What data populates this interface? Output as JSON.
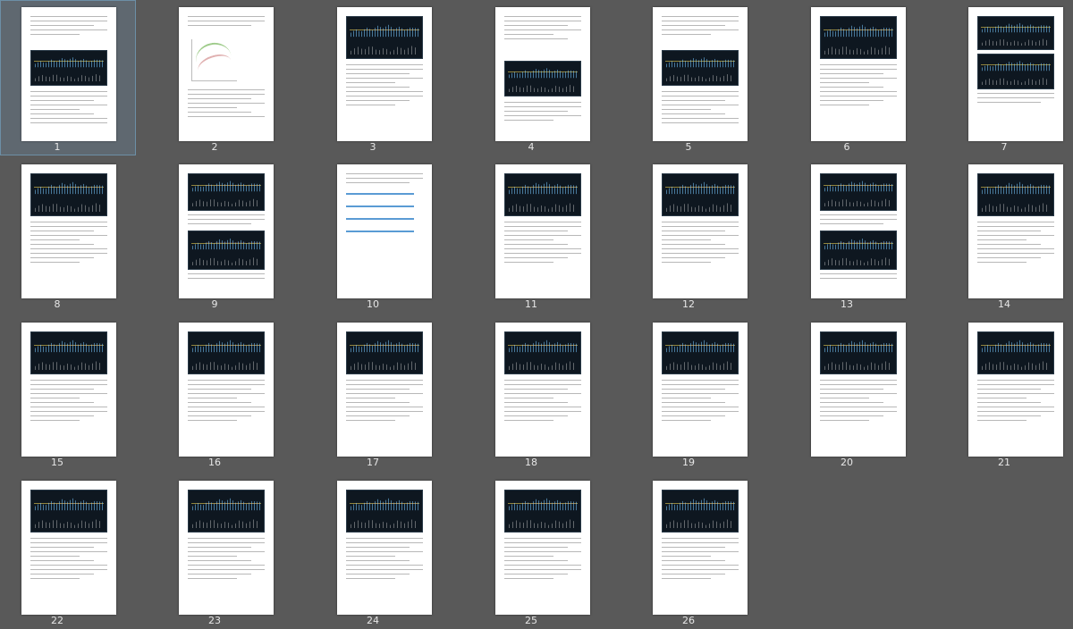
{
  "pages": [
    {
      "label": "1",
      "selected": true,
      "kind": "text-chart"
    },
    {
      "label": "2",
      "selected": false,
      "kind": "sketch"
    },
    {
      "label": "3",
      "selected": false,
      "kind": "chart-text"
    },
    {
      "label": "4",
      "selected": false,
      "kind": "text-chart-text"
    },
    {
      "label": "5",
      "selected": false,
      "kind": "text-chart"
    },
    {
      "label": "6",
      "selected": false,
      "kind": "chart-text"
    },
    {
      "label": "7",
      "selected": false,
      "kind": "two-charts"
    },
    {
      "label": "8",
      "selected": false,
      "kind": "chart-text"
    },
    {
      "label": "9",
      "selected": false,
      "kind": "chart-text-chart"
    },
    {
      "label": "10",
      "selected": false,
      "kind": "links"
    },
    {
      "label": "11",
      "selected": false,
      "kind": "chart-text"
    },
    {
      "label": "12",
      "selected": false,
      "kind": "chart-text"
    },
    {
      "label": "13",
      "selected": false,
      "kind": "chart-text-chart"
    },
    {
      "label": "14",
      "selected": false,
      "kind": "chart-text"
    },
    {
      "label": "15",
      "selected": false,
      "kind": "chart-text"
    },
    {
      "label": "16",
      "selected": false,
      "kind": "chart-text"
    },
    {
      "label": "17",
      "selected": false,
      "kind": "chart-text"
    },
    {
      "label": "18",
      "selected": false,
      "kind": "chart-text"
    },
    {
      "label": "19",
      "selected": false,
      "kind": "chart-text"
    },
    {
      "label": "20",
      "selected": false,
      "kind": "chart-text"
    },
    {
      "label": "21",
      "selected": false,
      "kind": "chart-text"
    },
    {
      "label": "22",
      "selected": false,
      "kind": "chart-text"
    },
    {
      "label": "23",
      "selected": false,
      "kind": "chart-text"
    },
    {
      "label": "24",
      "selected": false,
      "kind": "chart-text"
    },
    {
      "label": "25",
      "selected": false,
      "kind": "chart-text"
    },
    {
      "label": "26",
      "selected": false,
      "kind": "chart-text"
    }
  ],
  "colors": {
    "background": "#595959",
    "selection": "#6c8fa6",
    "page": "#ffffff",
    "chart": "#0e1720"
  }
}
